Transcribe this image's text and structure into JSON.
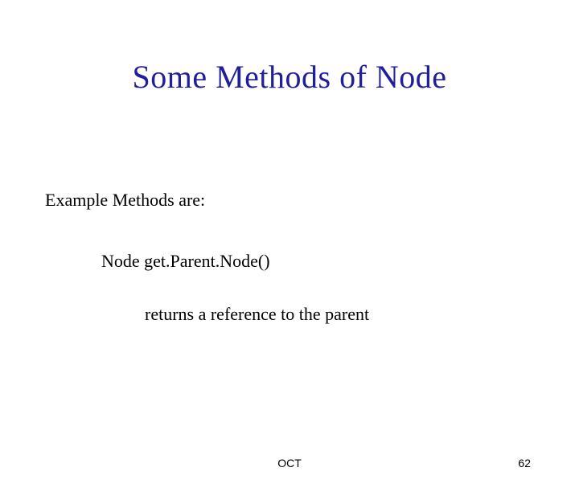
{
  "slide": {
    "title": "Some Methods of Node",
    "subhead": "Example Methods are:",
    "method": "Node get.Parent.Node()",
    "desc": "returns a reference to the parent",
    "footer_center": "OCT",
    "page_number": "62"
  }
}
